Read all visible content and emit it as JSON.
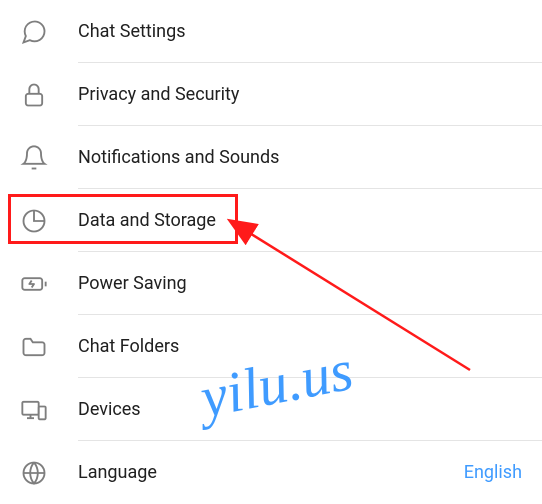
{
  "settings": {
    "items": [
      {
        "label": "Chat Settings"
      },
      {
        "label": "Privacy and Security"
      },
      {
        "label": "Notifications and Sounds"
      },
      {
        "label": "Data and Storage"
      },
      {
        "label": "Power Saving"
      },
      {
        "label": "Chat Folders"
      },
      {
        "label": "Devices"
      },
      {
        "label": "Language",
        "value": "English"
      }
    ]
  },
  "annotation": {
    "highlighted_item": "Data and Storage",
    "watermark_text": "yilu.us",
    "accent_color": "#3f9bff",
    "highlight_color": "#ff1a1a"
  }
}
